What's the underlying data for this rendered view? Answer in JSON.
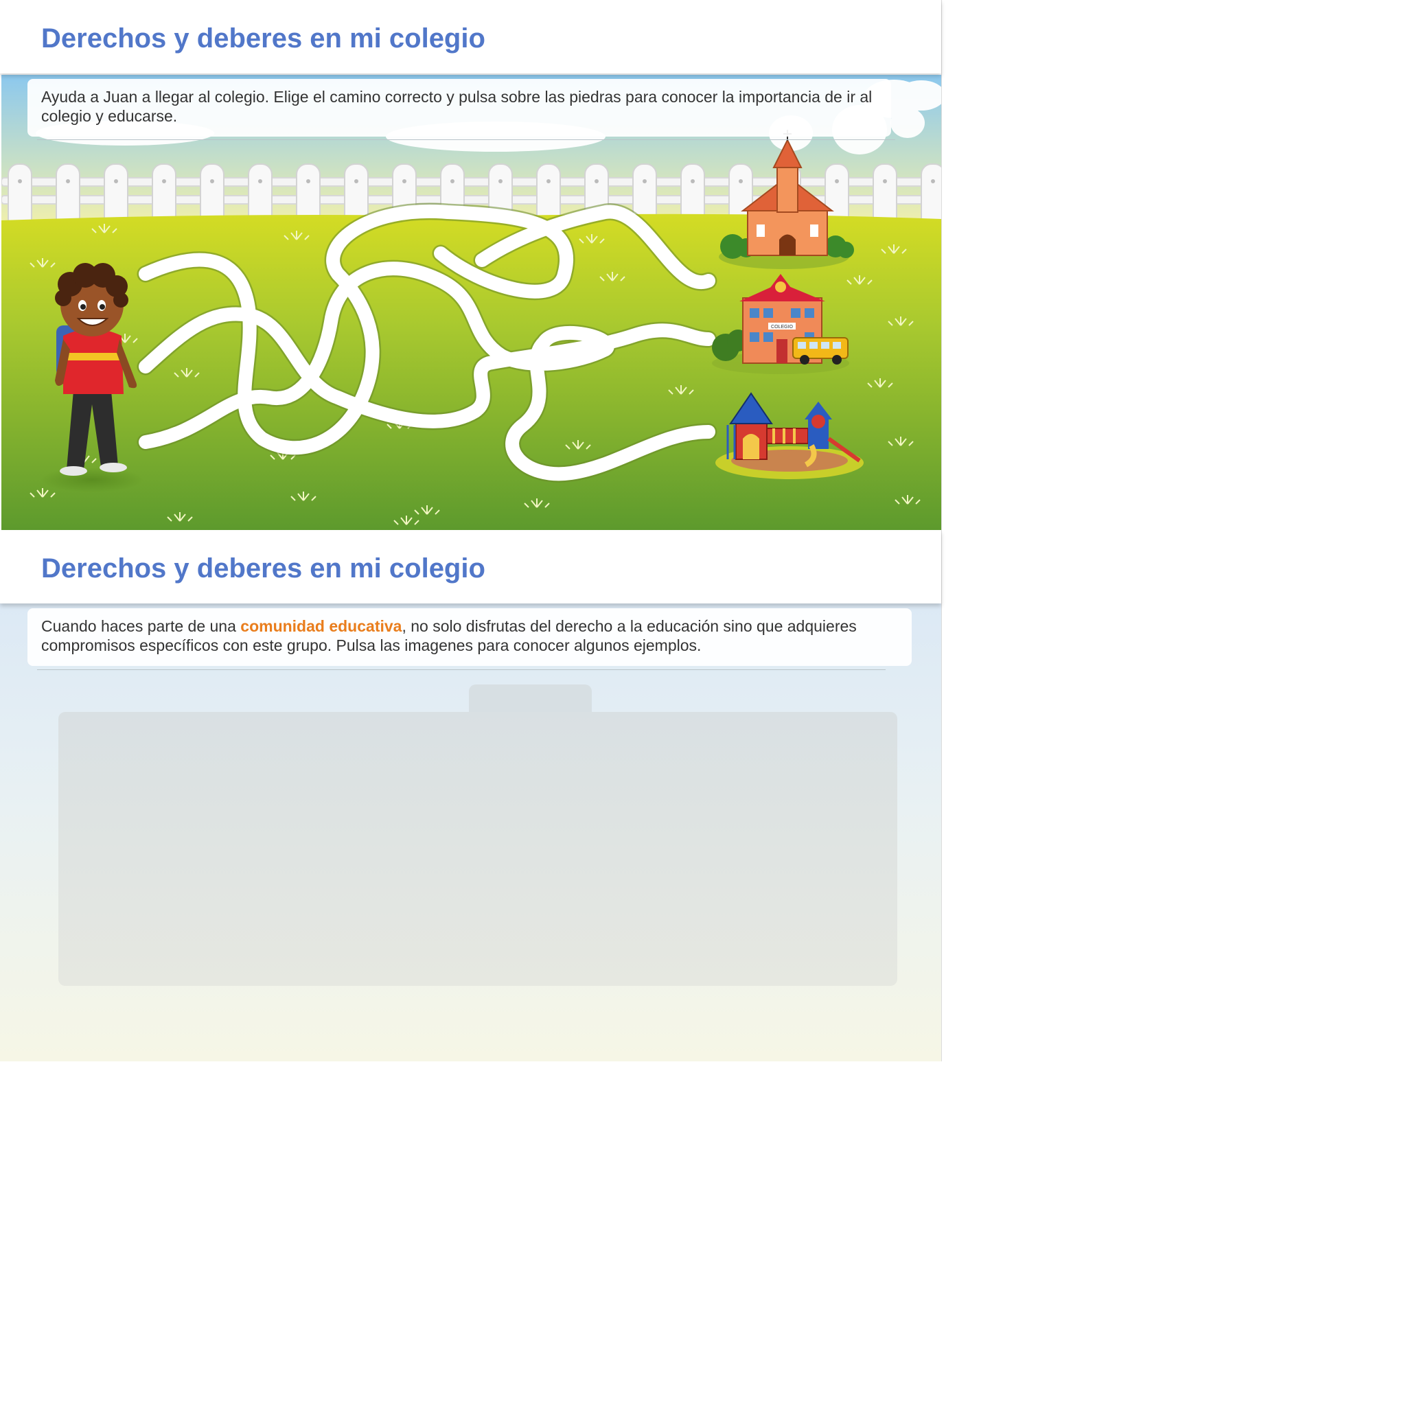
{
  "sections": [
    {
      "title": "Derechos y deberes en mi colegio",
      "instruction": "Ayuda a Juan a llegar al colegio. Elige el camino correcto y pulsa sobre las piedras para conocer la importancia de ir al colegio y educarse.",
      "scene": {
        "character": "boy-with-backpack",
        "destinations": [
          {
            "name": "church-icon"
          },
          {
            "name": "school-building-icon",
            "sign": "COLEGIO"
          },
          {
            "name": "playground-icon"
          }
        ]
      }
    },
    {
      "title": "Derechos y deberes en mi colegio",
      "instruction_before": "Cuando haces parte de una ",
      "instruction_highlight": "comunidad educativa",
      "instruction_after": ", no solo disfrutas del derecho a la educación sino que adquieres compromisos específicos con este grupo. Pulsa las imagenes para conocer algunos ejemplos."
    }
  ],
  "colors": {
    "title": "#5177c9",
    "highlight": "#e97d1c",
    "grass_top": "#cfd92a",
    "grass_bottom": "#5e9c2c",
    "sky": "#9fd0ef"
  }
}
